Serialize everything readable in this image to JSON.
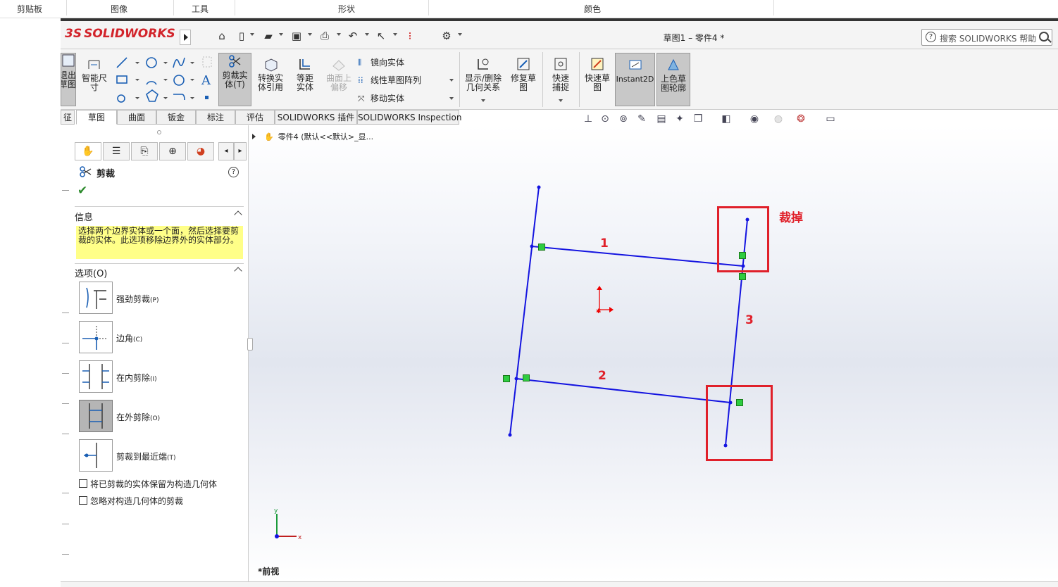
{
  "ribbon_groups": [
    "剪贴板",
    "图像",
    "工具",
    "形状",
    "颜色"
  ],
  "app": {
    "logo_prefix": "3S",
    "logo_text": "SOLIDWORKS",
    "doc_title": "草图1 – 零件4 *"
  },
  "search": {
    "placeholder": "搜索 SOLIDWORKS 帮助"
  },
  "commands": {
    "exit_sketch": "退出草图",
    "smart_dim": "智能尺寸",
    "trim": "剪裁实体(T)",
    "convert": "转换实体引用",
    "offset": "等距实体",
    "surface_offset": "曲面上偏移",
    "mirror": "镜向实体",
    "linear_pattern": "线性草图阵列",
    "move": "移动实体",
    "display_relations": "显示/删除几何关系",
    "repair": "修复草图",
    "quick_snap": "快速捕捉",
    "rapid_sketch": "快速草图",
    "instant2d": "Instant2D",
    "shaded": "上色草图轮廓"
  },
  "tabs": [
    "征",
    "草图",
    "曲面",
    "钣金",
    "标注",
    "评估",
    "SOLIDWORKS 插件",
    "SOLIDWORKS Inspection"
  ],
  "property_manager": {
    "title": "剪裁",
    "info_header": "信息",
    "info_text": "选择两个边界实体或一个面，然后选择要剪裁的实体。此选项移除边界外的实体部分。",
    "options_header": "选项(O)",
    "options": [
      {
        "label": "强劲剪裁",
        "key": "(P)"
      },
      {
        "label": "边角",
        "key": "(C)"
      },
      {
        "label": "在内剪除",
        "key": "(I)"
      },
      {
        "label": "在外剪除",
        "key": "(O)"
      },
      {
        "label": "剪裁到最近端",
        "key": "(T)"
      }
    ],
    "checkboxes": [
      "将已剪裁的实体保留为构造几何体",
      "忽略对构造几何体的剪裁"
    ]
  },
  "tree": {
    "text": "零件4 (默认<<默认>_显..."
  },
  "view": {
    "name": "*前视",
    "axis_x": "x",
    "axis_y": "y"
  },
  "annotations": {
    "trim": "裁掉",
    "line1": "1",
    "line2": "2",
    "line3": "3"
  },
  "colors": {
    "sketch": "#1414e0",
    "annotation": "#e0202a",
    "marker": "#2ecc40"
  }
}
